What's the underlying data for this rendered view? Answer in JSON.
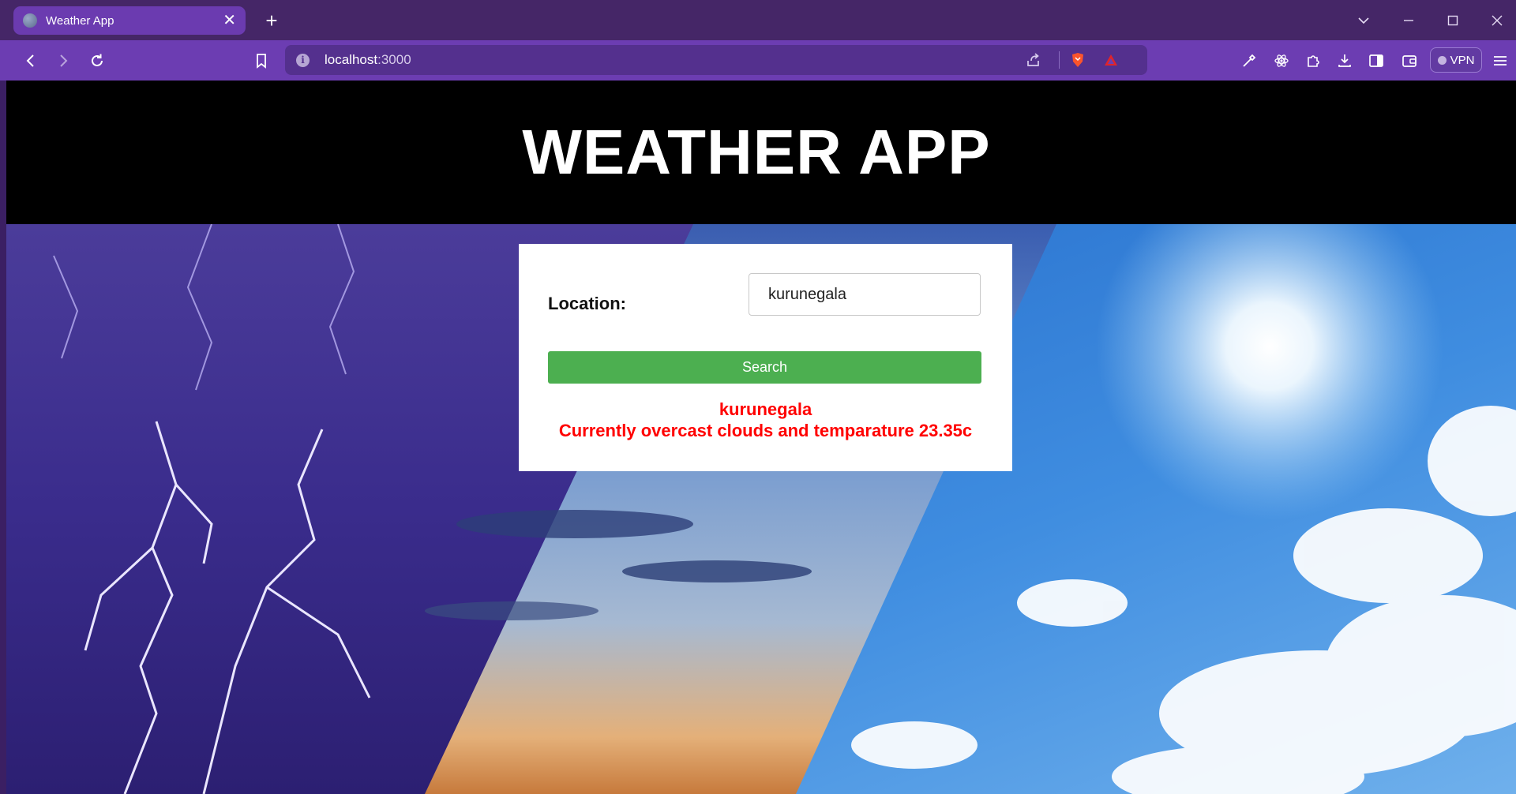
{
  "browser": {
    "tab_title": "Weather App",
    "tab_close": "✕",
    "new_tab": "+",
    "url_host": "localhost",
    "url_port": ":3000",
    "vpn_label": "VPN",
    "accent": "#6c3db2"
  },
  "page": {
    "heading": "WEATHER APP",
    "location_label": "Location:",
    "location_value": "kurunegala",
    "search_label": "Search",
    "result_city": "kurunegala",
    "result_text": "Currently overcast clouds and temparature 23.35c",
    "result_color": "#ff0000",
    "button_color": "#4caf50"
  }
}
